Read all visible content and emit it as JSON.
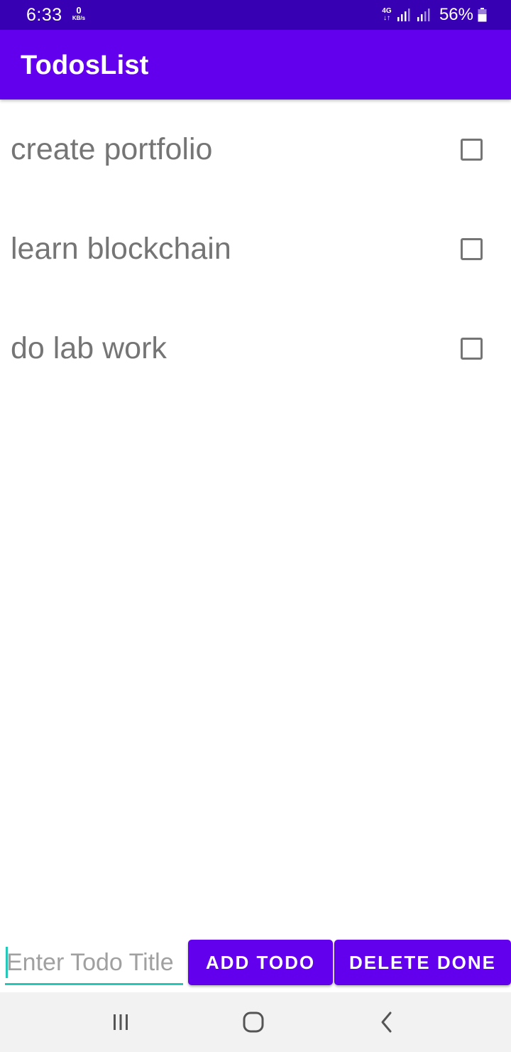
{
  "status_bar": {
    "time": "6:33",
    "net_speed_value": "0",
    "net_speed_unit": "KB/s",
    "network_type": "4G",
    "network_arrows": "↓↑",
    "battery_percent": "56%",
    "icons": [
      "signal-icon",
      "signal-icon",
      "battery-icon"
    ]
  },
  "app_bar": {
    "title": "TodosList",
    "color": "#6200ee"
  },
  "todos": [
    {
      "title": "create portfolio",
      "done": false
    },
    {
      "title": "learn blockchain",
      "done": false
    },
    {
      "title": "do lab work",
      "done": false
    }
  ],
  "input": {
    "placeholder": "Enter Todo Title",
    "value": ""
  },
  "buttons": {
    "add_label": "ADD TODO",
    "delete_label": "DELETE DONE"
  },
  "nav_bar": {
    "icons": [
      "recents-icon",
      "home-icon",
      "back-icon"
    ]
  },
  "colors": {
    "status_bar": "#3700b3",
    "primary": "#6200ee",
    "accent": "#26c6b8",
    "todo_text": "#757575"
  }
}
